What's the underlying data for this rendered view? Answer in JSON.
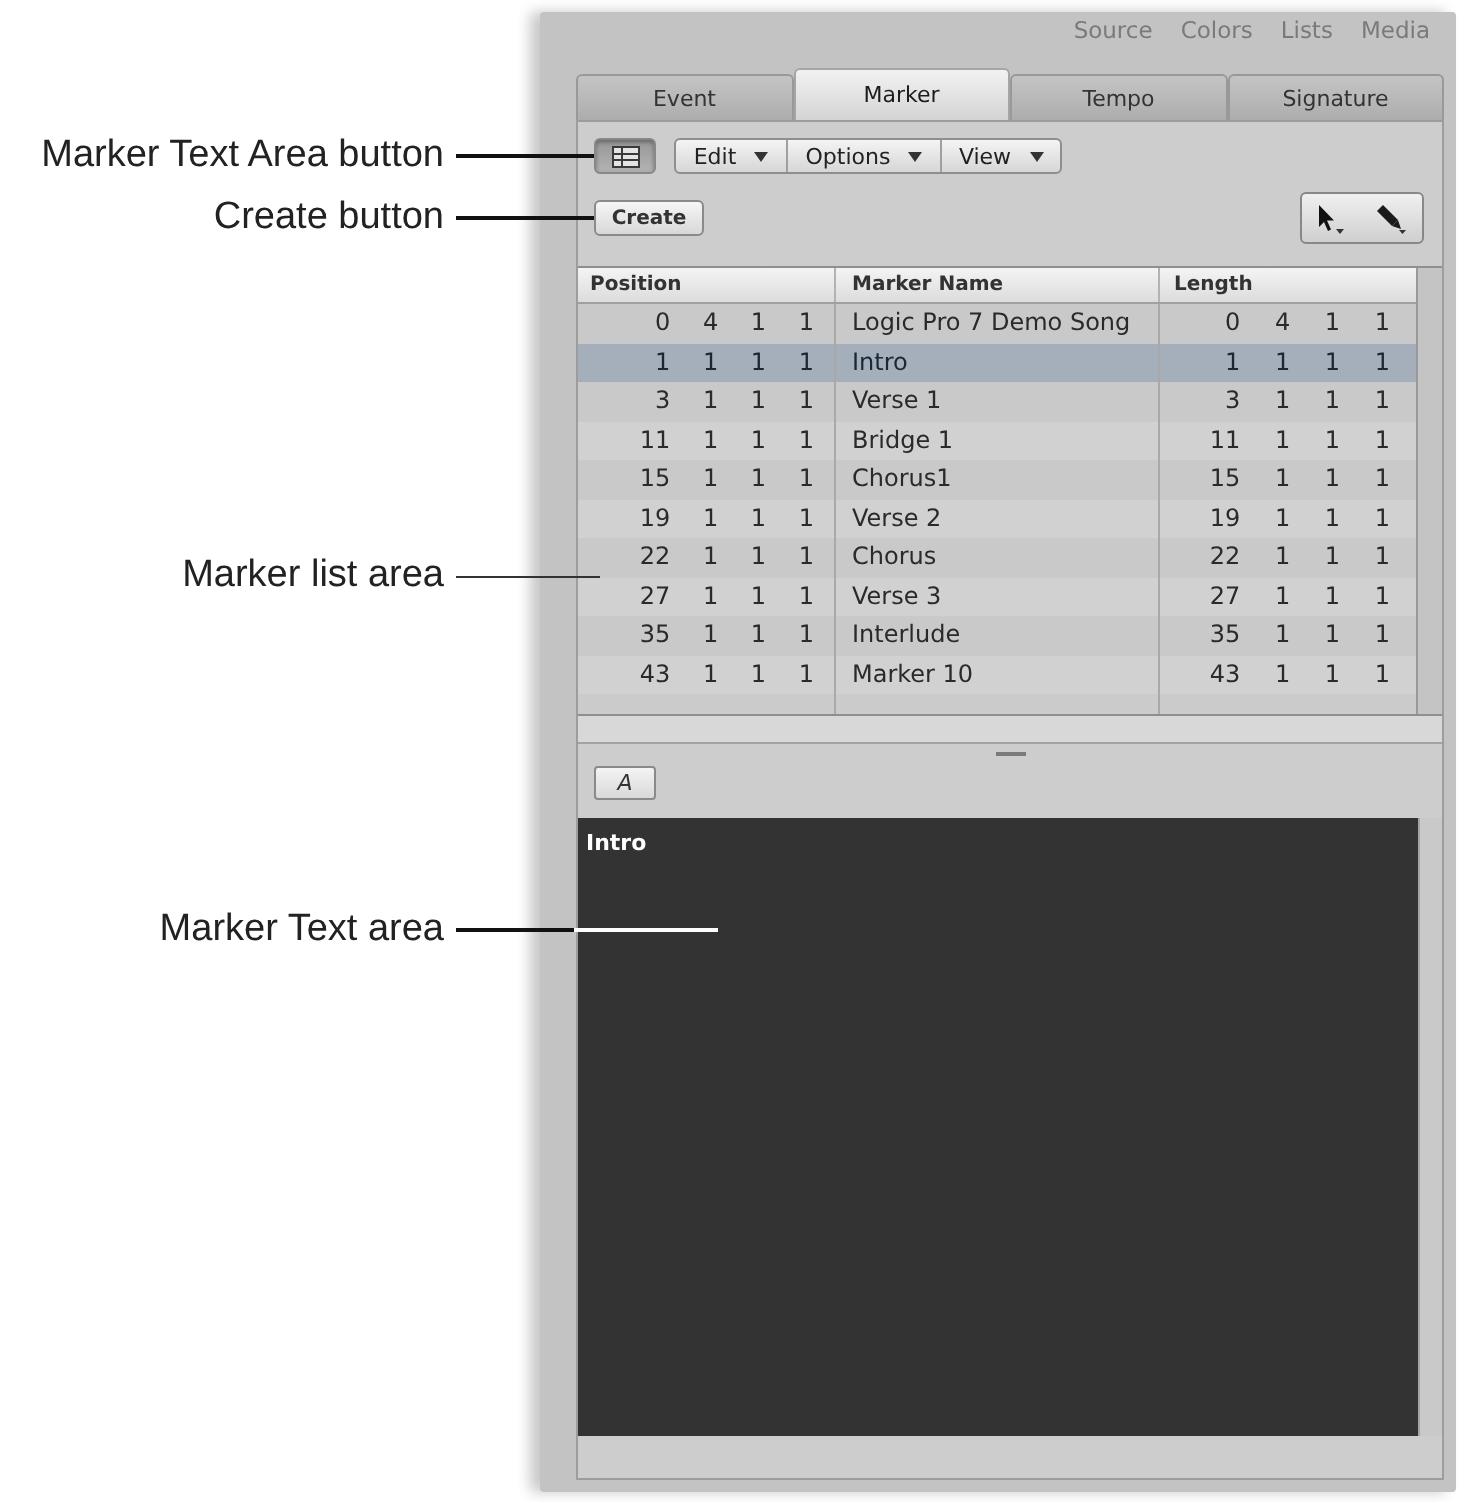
{
  "header_tabs": [
    {
      "label": "Source"
    },
    {
      "label": "Colors"
    },
    {
      "label": "Lists"
    },
    {
      "label": "Media"
    }
  ],
  "tabs": [
    {
      "label": "Event",
      "selected": false
    },
    {
      "label": "Marker",
      "selected": true
    },
    {
      "label": "Tempo",
      "selected": false
    },
    {
      "label": "Signature",
      "selected": false
    }
  ],
  "toolbar": {
    "text_area_button": {
      "on": true,
      "callout": "Marker Text Area button"
    },
    "menus": [
      {
        "label": "Edit"
      },
      {
        "label": "Options"
      },
      {
        "label": "View"
      }
    ],
    "create_button": {
      "label": "Create",
      "callout": "Create button"
    }
  },
  "table": {
    "callout": "Marker list area",
    "columns": [
      "Position",
      "Marker Name",
      "Length"
    ],
    "rows": [
      {
        "position": "0 4 1 1",
        "name": "Logic Pro 7 Demo Song",
        "length": "0 4 1 1",
        "selected": false
      },
      {
        "position": "1 1 1 1",
        "name": "Intro",
        "length": "1 1 1 1",
        "selected": true
      },
      {
        "position": "3 1 1 1",
        "name": "Verse 1",
        "length": "3 1 1 1",
        "selected": false
      },
      {
        "position": "11 1 1 1",
        "name": "Bridge 1",
        "length": "11 1 1 1",
        "selected": false
      },
      {
        "position": "15 1 1 1",
        "name": "Chorus1",
        "length": "15 1 1 1",
        "selected": false
      },
      {
        "position": "19 1 1 1",
        "name": "Verse 2",
        "length": "19 1 1 1",
        "selected": false
      },
      {
        "position": "22 1 1 1",
        "name": "Chorus",
        "length": "22 1 1 1",
        "selected": false
      },
      {
        "position": "27 1 1 1",
        "name": "Verse 3",
        "length": "27 1 1 1",
        "selected": false
      },
      {
        "position": "35 1 1 1",
        "name": "Interlude",
        "length": "35 1 1 1",
        "selected": false
      },
      {
        "position": "43 1 1 1",
        "name": "Marker 10",
        "length": "43 1 1 1",
        "selected": false
      }
    ]
  },
  "text_editor": {
    "callout": "Marker Text area",
    "font_button": "A",
    "value": "Intro"
  }
}
